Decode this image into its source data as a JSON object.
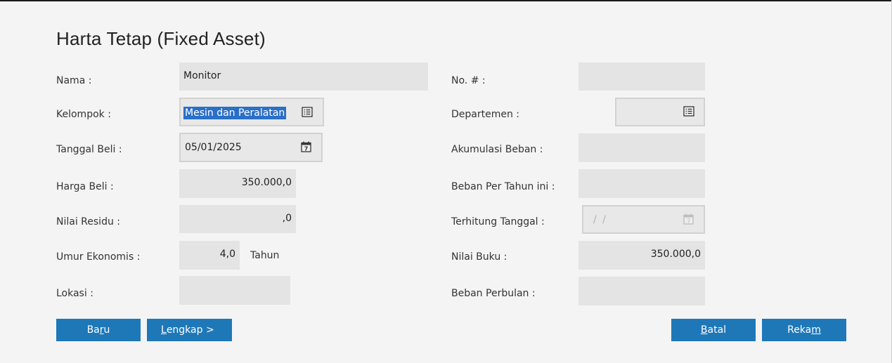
{
  "title": "Harta Tetap (Fixed Asset)",
  "left": {
    "nama": {
      "label": "Nama :",
      "value": "Monitor"
    },
    "kelompok": {
      "label": "Kelompok :",
      "value": "Mesin dan Peralatan"
    },
    "tanggal_beli": {
      "label": "Tanggal Beli :",
      "value": "05/01/2025"
    },
    "harga_beli": {
      "label": "Harga Beli :",
      "value": "350.000,0"
    },
    "nilai_residu": {
      "label": "Nilai Residu :",
      "value": ",0"
    },
    "umur_ekonomis": {
      "label": "Umur Ekonomis :",
      "value": "4,0",
      "unit": "Tahun"
    },
    "lokasi": {
      "label": "Lokasi :",
      "value": ""
    }
  },
  "right": {
    "no": {
      "label": "No. # :",
      "value": ""
    },
    "departemen": {
      "label": "Departemen :",
      "value": ""
    },
    "akumulasi_beban": {
      "label": "Akumulasi Beban :",
      "value": ""
    },
    "beban_per_tahun": {
      "label": "Beban Per Tahun ini :",
      "value": ""
    },
    "terhitung_tanggal": {
      "label": "Terhitung Tanggal :",
      "value": "/ /"
    },
    "nilai_buku": {
      "label": "Nilai Buku :",
      "value": "350.000,0"
    },
    "beban_perbulan": {
      "label": "Beban Perbulan :",
      "value": ""
    }
  },
  "buttons": {
    "baru": {
      "pre": "Ba",
      "mnemonic": "r",
      "post": "u"
    },
    "lengkap": {
      "pre": "",
      "mnemonic": "L",
      "post": "engkap >"
    },
    "batal": {
      "pre": "",
      "mnemonic": "B",
      "post": "atal"
    },
    "rekam": {
      "pre": "Reka",
      "mnemonic": "m",
      "post": ""
    }
  },
  "colors": {
    "button": "#1e78b8",
    "selection": "#2a6fc9",
    "field": "#e4e4e4",
    "background": "#f4f4f4"
  },
  "icons": {
    "list": "list-lookup-icon",
    "calendar": "calendar-icon"
  }
}
